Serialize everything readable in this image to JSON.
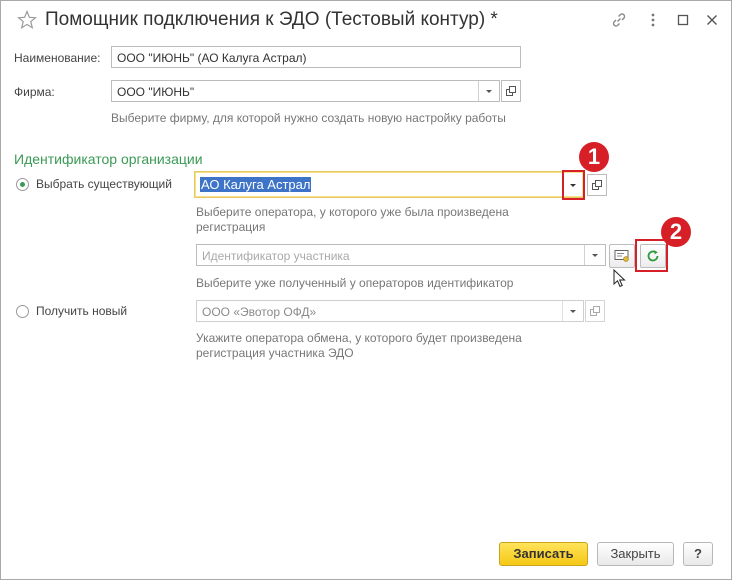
{
  "window": {
    "title": "Помощник подключения к ЭДО (Тестовый контур) *"
  },
  "form": {
    "name_label": "Наименование:",
    "name_value": "ООО \"ИЮНЬ\" (АО Калуга Астрал)",
    "firm_label": "Фирма:",
    "firm_value": "ООО \"ИЮНЬ\"",
    "firm_hint": "Выберите фирму, для которой нужно создать новую настройку работы"
  },
  "org_identifier": {
    "section_title": "Идентификатор организации",
    "existing": {
      "radio_label": "Выбрать существующий",
      "selected": true,
      "operator_value": "АО Калуга Астрал",
      "operator_hint": "Выберите оператора, у которого уже была произведена регистрация",
      "participant_placeholder": "Идентификатор участника",
      "participant_hint": "Выберите уже полученный у операторов идентификатор"
    },
    "new": {
      "radio_label": "Получить новый",
      "selected": false,
      "operator_value": "ООО «Эвотор ОФД»",
      "operator_hint": "Укажите оператора обмена, у которого будет произведена регистрация участника ЭДО"
    }
  },
  "annotations": {
    "badge_1": "1",
    "badge_2": "2",
    "color": "#d61f26"
  },
  "footer": {
    "save_label": "Записать",
    "close_label": "Закрыть",
    "help_label": "?"
  },
  "icons": [
    "star-icon",
    "link-icon",
    "more-icon",
    "maximize-icon",
    "close-icon",
    "open-form-icon",
    "dropdown-arrow-icon",
    "certificate-icon",
    "refresh-icon",
    "mouse-cursor-icon"
  ]
}
